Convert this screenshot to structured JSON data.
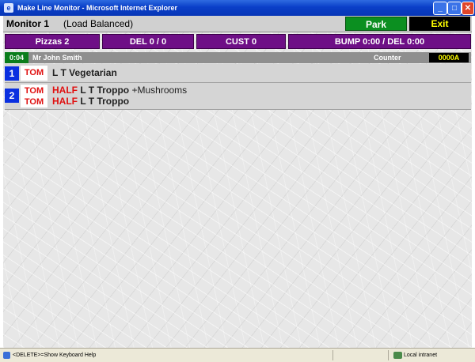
{
  "window": {
    "title": "Make Line Monitor - Microsoft Internet Explorer",
    "icon": "ie-icon"
  },
  "header": {
    "monitor_title": "Monitor 1",
    "mode": "(Load Balanced)",
    "park_label": "Park",
    "exit_label": "Exit"
  },
  "stats": {
    "pizzas": "Pizzas  2",
    "del": "DEL  0 / 0",
    "cust": "CUST  0",
    "bump": "BUMP  0:00  /  DEL  0:00"
  },
  "order": {
    "timer": "0:04",
    "customer": "Mr John Smith",
    "counter_label": "Counter",
    "order_number": "0000A",
    "items": [
      {
        "number": "1",
        "toppings": [
          "TOM"
        ],
        "lines": [
          {
            "half": "",
            "name": "L T Vegetarian",
            "extra": ""
          }
        ]
      },
      {
        "number": "2",
        "toppings": [
          "TOM",
          "TOM"
        ],
        "lines": [
          {
            "half": "HALF",
            "name": "L T Troppo",
            "extra": "+Mushrooms"
          },
          {
            "half": "HALF",
            "name": "L T Troppo",
            "extra": ""
          }
        ]
      }
    ]
  },
  "statusbar": {
    "text": "<DELETE>=Show Keyboard Help",
    "zone": "Local intranet"
  },
  "colors": {
    "titlebar": "#0a3fc8",
    "park": "#0b8f20",
    "exit_bg": "#000000",
    "exit_text": "#ffff00",
    "stats": "#6e0f86",
    "item_number": "#0a2fe0",
    "topping_text": "#e01010"
  }
}
